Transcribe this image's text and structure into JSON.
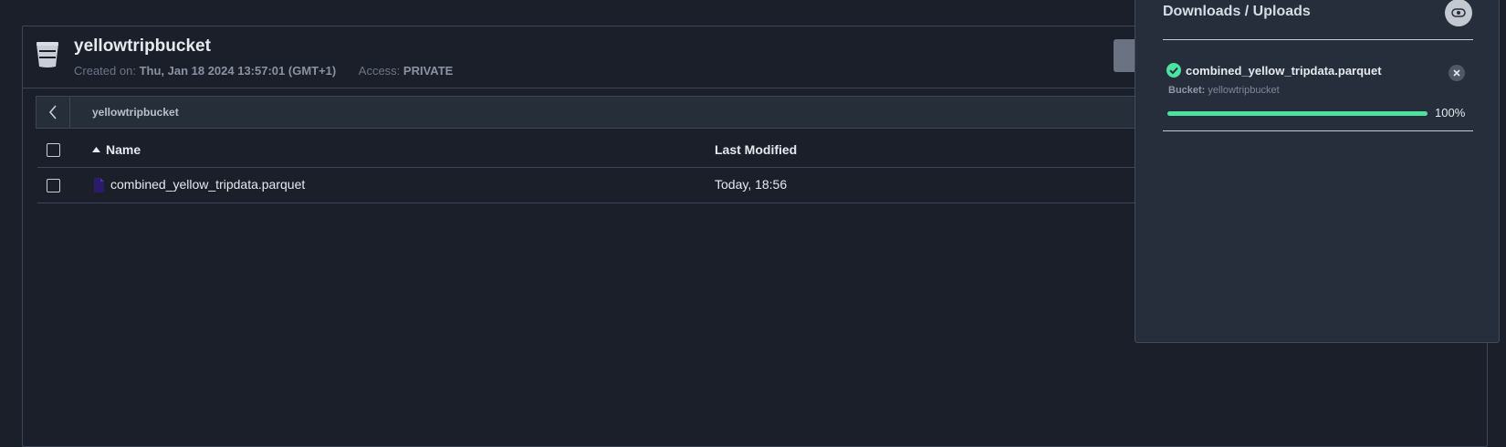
{
  "bucket": {
    "name": "yellowtripbucket",
    "created_label": "Created on:",
    "created_value": "Thu, Jan 18 2024 13:57:01 (GMT+1)",
    "access_label": "Access:",
    "access_value": "PRIVATE",
    "icon": "bucket-icon"
  },
  "path": {
    "back_icon": "chevron-left-icon",
    "current": "yellowtripbucket"
  },
  "table": {
    "columns": [
      "Name",
      "Last Modified"
    ],
    "sort_icon": "caret-up-icon",
    "rows": [
      {
        "name": "combined_yellow_tripdata.parquet",
        "last_modified": "Today, 18:56",
        "icon": "file-icon"
      }
    ]
  },
  "downloads": {
    "title": "Downloads / Uploads",
    "hide_icon": "eye-off-icon",
    "items": [
      {
        "name": "combined_yellow_tripdata.parquet",
        "bucket_label": "Bucket:",
        "bucket_value": "yellowtripbucket",
        "progress": 100,
        "progress_text": "100%",
        "status_icon": "check-circle-icon",
        "close_icon": "close-icon"
      }
    ]
  },
  "colors": {
    "background": "#1a1f29",
    "panel": "#262e3b",
    "progress": "#4ee2a1",
    "success": "#4ee2a1"
  }
}
